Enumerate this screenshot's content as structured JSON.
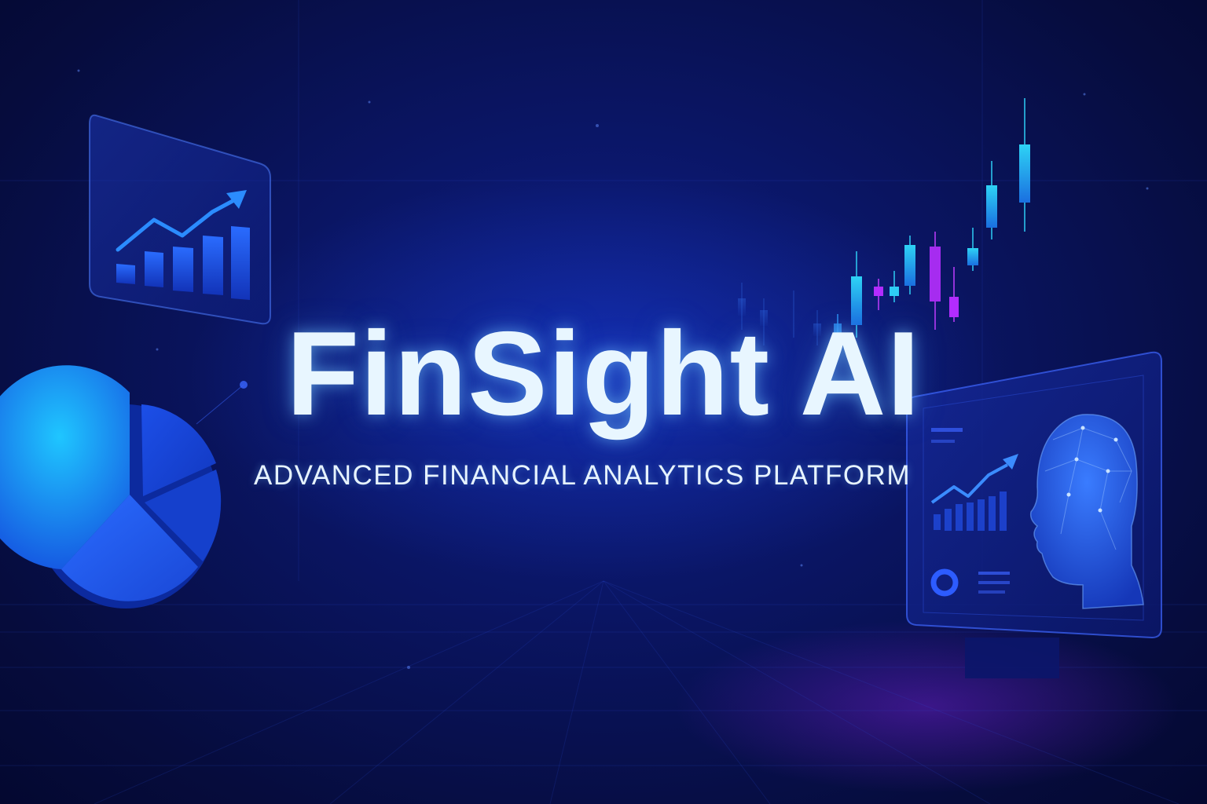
{
  "hero": {
    "title": "FinSight AI",
    "subtitle": "ADVANCED FINANCIAL ANALYTICS PLATFORM"
  },
  "colors": {
    "background": "#0a1563",
    "title": "#e8f6ff",
    "accent_cyan": "#22c9f0",
    "accent_blue": "#1f6bff",
    "accent_magenta": "#b22cff"
  },
  "decor": {
    "left_card_icon": "bar-chart-with-trend-arrow-icon",
    "pie_icon": "pie-chart-icon",
    "candles_icon": "candlestick-chart-icon",
    "monitor_icon": "ai-head-dashboard-monitor-icon"
  }
}
